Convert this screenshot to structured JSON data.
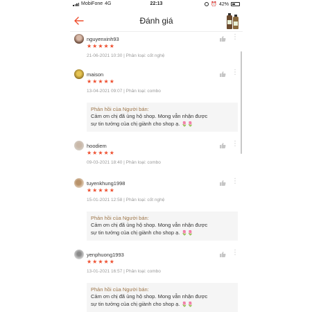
{
  "status_bar": {
    "carrier": "MobiFone",
    "network": "4G",
    "time": "22:13",
    "battery": "42%"
  },
  "header": {
    "title": "Đánh giá"
  },
  "reviews": [
    {
      "username": "nguyenxinh93",
      "rating": 5,
      "date": "21-06-2021 10:30",
      "variant": "Phân loại: cốt nghệ"
    },
    {
      "username": "maison",
      "rating": 5,
      "date": "13-04-2021 09:07",
      "variant": "Phân loại: combo",
      "reply_title": "Phản hồi của Người bán:",
      "reply_line1": "Cảm ơn chị đã ủng hộ shop. Mong vẫn nhận được",
      "reply_line2": "sự tin tưởng của chị giành cho shop ạ."
    },
    {
      "username": "hoodiem",
      "rating": 5,
      "date": "09-03-2021 18:40",
      "variant": "Phân loại: combo"
    },
    {
      "username": "tuyenkhung1998",
      "rating": 5,
      "date": "15-01-2021 12:58",
      "variant": "Phân loại: cốt nghệ",
      "reply_title": "Phản hồi của Người bán:",
      "reply_line1": "Cảm ơn chị đã ủng hộ shop. Mong vẫn nhận được",
      "reply_line2": "sự tin tưởng của chị giành cho shop ạ."
    },
    {
      "username": "yenphuong1993",
      "rating": 5,
      "date": "13-01-2021 16:57",
      "variant": "Phân loại: combo",
      "reply_title": "Phản hồi của Người bán:",
      "reply_line1": "Cảm ơn chị đã ủng hộ shop. Mong vẫn nhận được",
      "reply_line2": "sự tin tưởng của chị giành cho shop ạ."
    }
  ],
  "separator": "|",
  "icons": {
    "back": "back-arrow-icon",
    "like": "thumbs-up-icon",
    "more": "more-vertical-icon",
    "star": "star-icon",
    "flower": "tulip-icon"
  },
  "colors": {
    "accent": "#ee4d2d",
    "reply_title": "#9c7447",
    "reply_bg": "#f5f5f5",
    "muted": "#9a9a9a"
  }
}
